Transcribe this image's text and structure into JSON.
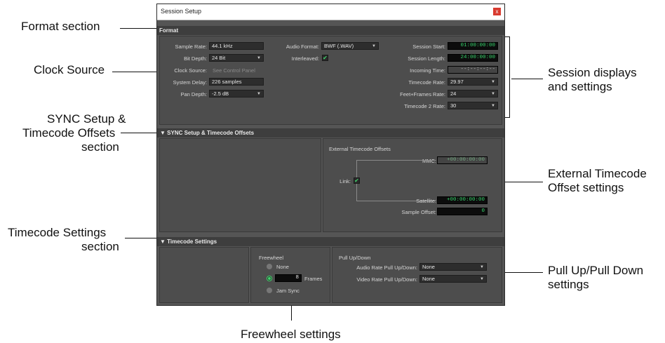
{
  "window": {
    "title": "Session Setup",
    "close_glyph": "x"
  },
  "callouts": {
    "format_section": "Format section",
    "clock_source": "Clock Source",
    "sync_section_l1": "SYNC Setup &",
    "sync_section_l2": "Timecode Offsets",
    "sync_section_l3": "section",
    "timecode_section_l1": "Timecode Settings",
    "timecode_section_l2": "section",
    "session_displays_l1": "Session displays",
    "session_displays_l2": "and settings",
    "ext_tc_l1": "External Timecode",
    "ext_tc_l2": "Offset settings",
    "pullup_l1": "Pull Up/Pull Down",
    "pullup_l2": "settings",
    "freewheel": "Freewheel settings"
  },
  "format": {
    "header": "Format",
    "sample_rate": {
      "label": "Sample Rate:",
      "value": "44.1 kHz"
    },
    "bit_depth": {
      "label": "Bit Depth:",
      "value": "24 Bit"
    },
    "clock_source": {
      "label": "Clock Source:",
      "value": "See Control Panel"
    },
    "system_delay": {
      "label": "System Delay:",
      "value": "226 samples"
    },
    "pan_depth": {
      "label": "Pan Depth:",
      "value": "-2.5 dB"
    },
    "audio_format": {
      "label": "Audio Format:",
      "value": "BWF (.WAV)"
    },
    "interleaved": {
      "label": "Interleaved:",
      "checked": true
    },
    "session_start": {
      "label": "Session Start:",
      "value": "01:00:00:00"
    },
    "session_length": {
      "label": "Session Length:",
      "value": "24:00:00:00"
    },
    "incoming_time": {
      "label": "Incoming Time:",
      "value": "--:--:--:--"
    },
    "timecode_rate": {
      "label": "Timecode Rate:",
      "value": "29.97"
    },
    "feet_frames_rate": {
      "label": "Feet+Frames Rate:",
      "value": "24"
    },
    "timecode2_rate": {
      "label": "Timecode 2 Rate:",
      "value": "30"
    }
  },
  "sync": {
    "header": "▼ SYNC Setup & Timecode Offsets",
    "ext_title": "External Timecode Offsets",
    "mmc": {
      "label": "MMC:",
      "value": "+00:00:00:00"
    },
    "link": {
      "label": "Link:",
      "checked": true
    },
    "satellite": {
      "label": "Satellite:",
      "value": "+00:00:00:00"
    },
    "sample_offset": {
      "label": "Sample Offset:",
      "value": "0"
    }
  },
  "timecode": {
    "header": "▼ Timecode Settings",
    "freewheel_title": "Freewheel",
    "none_label": "None",
    "frames_value": "8",
    "frames_label": "Frames",
    "jam_sync_label": "Jam Sync",
    "pull_title": "Pull Up/Down",
    "audio_pull": {
      "label": "Audio Rate Pull Up/Down:",
      "value": "None"
    },
    "video_pull": {
      "label": "Video Rate Pull Up/Down:",
      "value": "None"
    }
  },
  "colors": {
    "timecode_green": "#36d36b",
    "close_red": "#d83a2f",
    "window_bg": "#555555"
  }
}
